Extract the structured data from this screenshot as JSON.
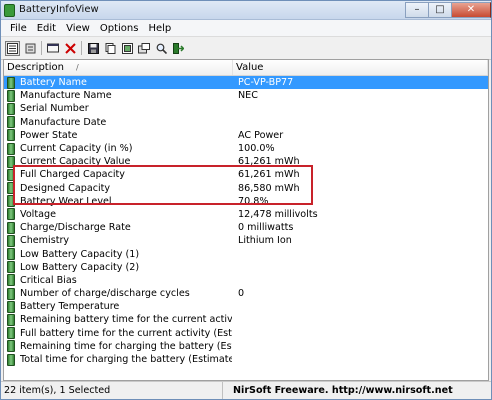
{
  "window": {
    "title": "BatteryInfoView",
    "buttons": {
      "minimize": "–",
      "maximize": "□",
      "close": "✕"
    }
  },
  "menu": [
    "File",
    "Edit",
    "View",
    "Options",
    "Help"
  ],
  "toolbar": {
    "icons": [
      "html-report-icon",
      "properties-icon",
      "refresh-icon",
      "delete-icon",
      "save-icon",
      "copy-icon",
      "copy-all-icon",
      "options-icon",
      "find-icon",
      "exit-icon"
    ]
  },
  "columns": {
    "description": "Description",
    "value": "Value",
    "sort_indicator": "/"
  },
  "rows": [
    {
      "description": "Battery Name",
      "value": "PC-VP-BP77",
      "selected": true
    },
    {
      "description": "Manufacture Name",
      "value": "NEC"
    },
    {
      "description": "Serial Number",
      "value": ""
    },
    {
      "description": "Manufacture Date",
      "value": ""
    },
    {
      "description": "Power State",
      "value": "AC Power"
    },
    {
      "description": "Current Capacity (in %)",
      "value": "100.0%"
    },
    {
      "description": "Current Capacity Value",
      "value": "61,261 mWh"
    },
    {
      "description": "Full Charged Capacity",
      "value": "61,261 mWh"
    },
    {
      "description": "Designed Capacity",
      "value": "86,580 mWh"
    },
    {
      "description": "Battery Wear Level",
      "value": "70.8%"
    },
    {
      "description": "Voltage",
      "value": "12,478 millivolts"
    },
    {
      "description": "Charge/Discharge Rate",
      "value": "0 milliwatts"
    },
    {
      "description": "Chemistry",
      "value": "Lithium Ion"
    },
    {
      "description": "Low Battery Capacity (1)",
      "value": ""
    },
    {
      "description": "Low Battery Capacity (2)",
      "value": ""
    },
    {
      "description": "Critical Bias",
      "value": ""
    },
    {
      "description": "Number of charge/discharge cycles",
      "value": "0"
    },
    {
      "description": "Battery Temperature",
      "value": ""
    },
    {
      "description": "Remaining battery time for the current activity (Est...",
      "value": ""
    },
    {
      "description": "Full battery time for the current activity (Estimated)",
      "value": ""
    },
    {
      "description": "Remaining time for charging the battery (Estimated)",
      "value": ""
    },
    {
      "description": "Total  time for charging the battery (Estimated)",
      "value": ""
    }
  ],
  "status": {
    "items": "22 item(s), 1 Selected",
    "credit": "NirSoft Freeware.  http://www.nirsoft.net"
  },
  "colors": {
    "selection": "#3399ff",
    "annotation_box": "#c8222a",
    "battery_icon": "#2f7d2f"
  }
}
